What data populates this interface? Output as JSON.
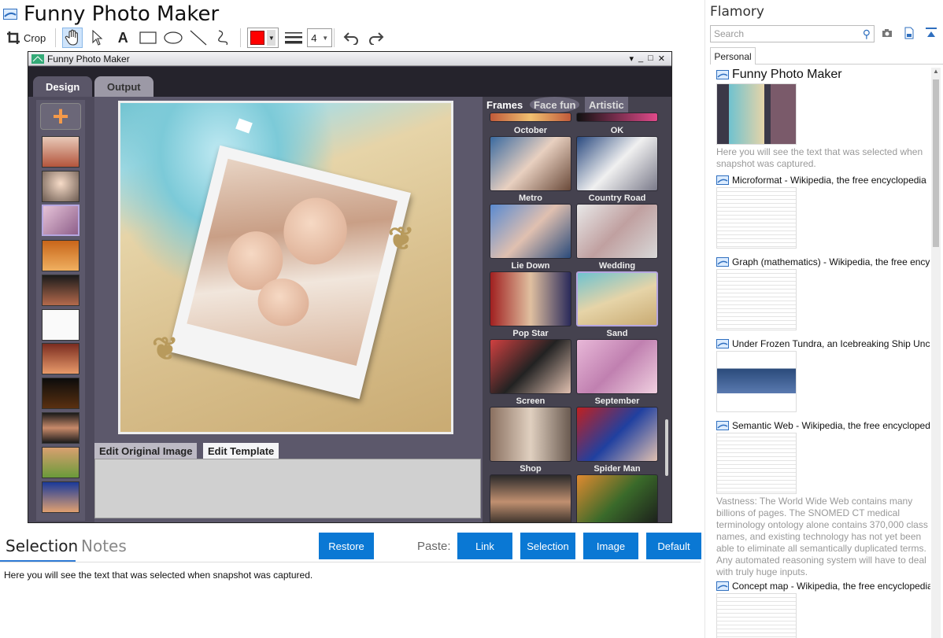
{
  "app": {
    "title": "Funny Photo Maker"
  },
  "toolbar": {
    "crop_label": "Crop",
    "tools": [
      "hand-icon",
      "pointer-icon",
      "text-icon",
      "rectangle-icon",
      "ellipse-icon",
      "line-icon",
      "freehand-icon"
    ],
    "color": "#ff0000",
    "line_width": "4"
  },
  "screenshot": {
    "window_title": "Funny Photo Maker",
    "tabs": {
      "design": "Design",
      "output": "Output"
    },
    "edit_tabs": {
      "original": "Edit Original Image",
      "template": "Edit Template"
    },
    "frame_tabs": {
      "frames": "Frames",
      "face_fun": "Face fun",
      "artistic": "Artistic"
    },
    "frames": [
      "October",
      "OK",
      "Metro",
      "Country Road",
      "Lie Down",
      "Wedding",
      "Pop Star",
      "Sand",
      "Screen",
      "September",
      "Shop",
      "Spider Man"
    ]
  },
  "bottom": {
    "tab_selection": "Selection",
    "tab_notes": "Notes",
    "restore": "Restore",
    "paste_label": "Paste:",
    "paste_link": "Link",
    "paste_selection": "Selection",
    "paste_image": "Image",
    "paste_default": "Default",
    "selection_text": "Here you will see the text that was selected when snapshot was captured."
  },
  "side": {
    "title": "Flamory",
    "search_placeholder": "Search",
    "tab": "Personal",
    "items": [
      {
        "title": "Funny Photo Maker",
        "desc": "Here you will see the text that was selected when snapshot was captured."
      },
      {
        "title": "Microformat - Wikipedia, the free encyclopedia",
        "desc": ""
      },
      {
        "title": "Graph (mathematics) - Wikipedia, the free ency",
        "desc": ""
      },
      {
        "title": "Under Frozen Tundra, an Icebreaking Ship Unco",
        "desc": ""
      },
      {
        "title": "Semantic Web - Wikipedia, the free encycloped",
        "desc": "Vastness: The World Wide Web contains many billions of pages. The SNOMED CT medical terminology ontology alone contains 370,000 class names, and existing technology has not yet been able to eliminate all semantically duplicated terms. Any automated reasoning system will have to deal with truly huge inputs."
      },
      {
        "title": "Concept map - Wikipedia, the free encyclopedia",
        "desc": ""
      }
    ]
  },
  "colors": {
    "accent": "#0a78d4",
    "shot_bg": "#4e4a5c"
  }
}
